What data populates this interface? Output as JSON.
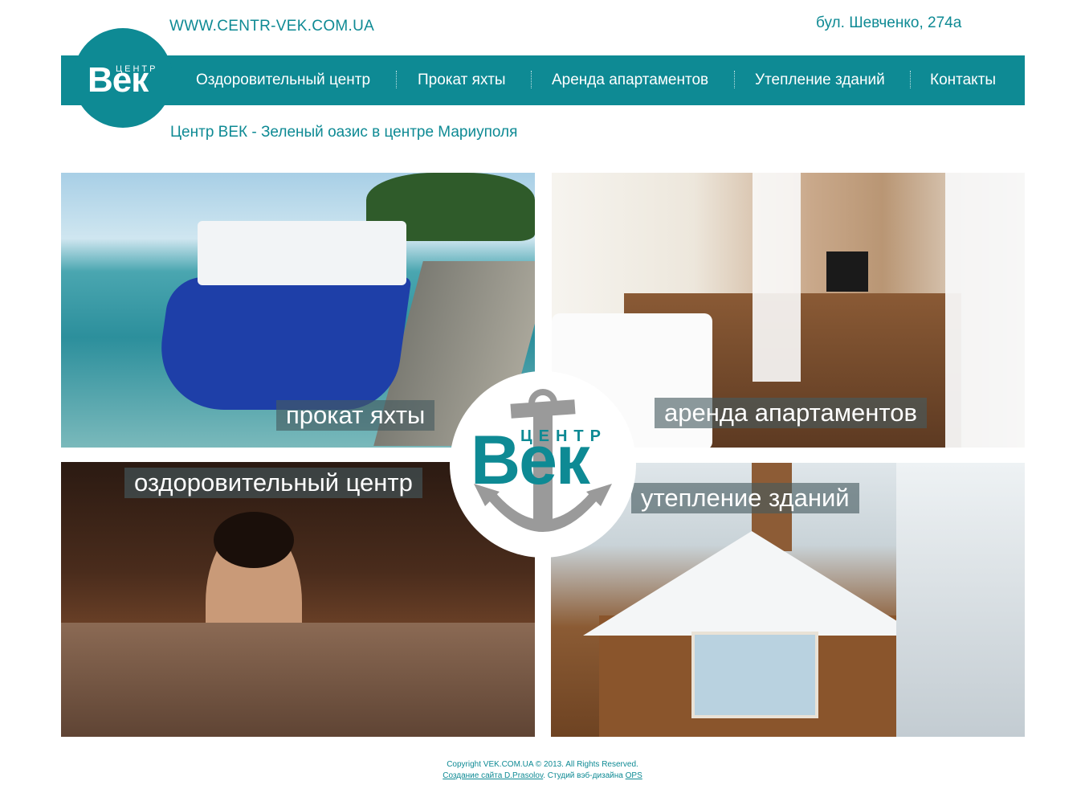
{
  "header": {
    "site_url": "WWW.CENTR-VEK.COM.UA",
    "address": "бул. Шевченко, 274а",
    "tagline": "Центр ВЕК - Зеленый оазис в центре Мариуполя"
  },
  "logo": {
    "small_word": "ЦЕНТР",
    "brand": "Век"
  },
  "nav": {
    "items": [
      {
        "label": "Оздоровительный центр"
      },
      {
        "label": "Прокат яхты"
      },
      {
        "label": "Аренда апартаментов"
      },
      {
        "label": "Утепление зданий"
      },
      {
        "label": "Контакты"
      }
    ]
  },
  "tiles": {
    "yacht": {
      "caption": "прокат яхты"
    },
    "apartments": {
      "caption": "аренда апартаментов"
    },
    "health": {
      "caption": "оздоровительный центр"
    },
    "insulation": {
      "caption": "утепление зданий"
    }
  },
  "center_badge": {
    "small_word": "ЦЕНТР",
    "brand": "Век"
  },
  "footer": {
    "copyright": "Copyright VEK.COM.UA © 2013. All Rights Reserved.",
    "credit_link": "Создание сайта D.Prasolov",
    "credit_separator": ". Студий вэб-дизайна",
    "studio_link": "OPS"
  },
  "colors": {
    "brand_teal": "#0e8a94",
    "anchor_gray": "#9a9a9a",
    "white": "#ffffff"
  }
}
